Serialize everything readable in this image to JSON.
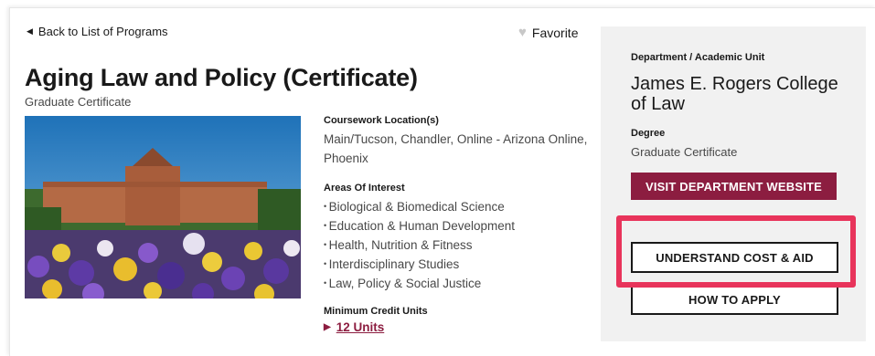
{
  "nav": {
    "back_label": "Back to List of Programs",
    "favorite_label": "Favorite"
  },
  "program": {
    "title": "Aging Law and Policy (Certificate)",
    "subtitle": "Graduate Certificate"
  },
  "details": {
    "location_label": "Coursework Location(s)",
    "location_value": "Main/Tucson, Chandler, Online - Arizona Online, Phoenix",
    "areas_label": "Areas Of Interest",
    "areas": [
      "Biological & Biomedical Science",
      "Education & Human Development",
      "Health, Nutrition & Fitness",
      "Interdisciplinary Studies",
      "Law, Policy & Social Justice"
    ],
    "credits_label": "Minimum Credit Units",
    "credits_value": "12 Units"
  },
  "sidebar": {
    "dept_label": "Department / Academic Unit",
    "dept_value": "James E. Rogers College of Law",
    "degree_label": "Degree",
    "degree_value": "Graduate Certificate",
    "visit_button": "VISIT DEPARTMENT WEBSITE",
    "cost_button": "UNDERSTAND COST & AID",
    "apply_button": "HOW TO APPLY"
  },
  "colors": {
    "brand_red": "#8c1d40",
    "highlight": "#e8345b",
    "panel_bg": "#f1f1f1"
  }
}
